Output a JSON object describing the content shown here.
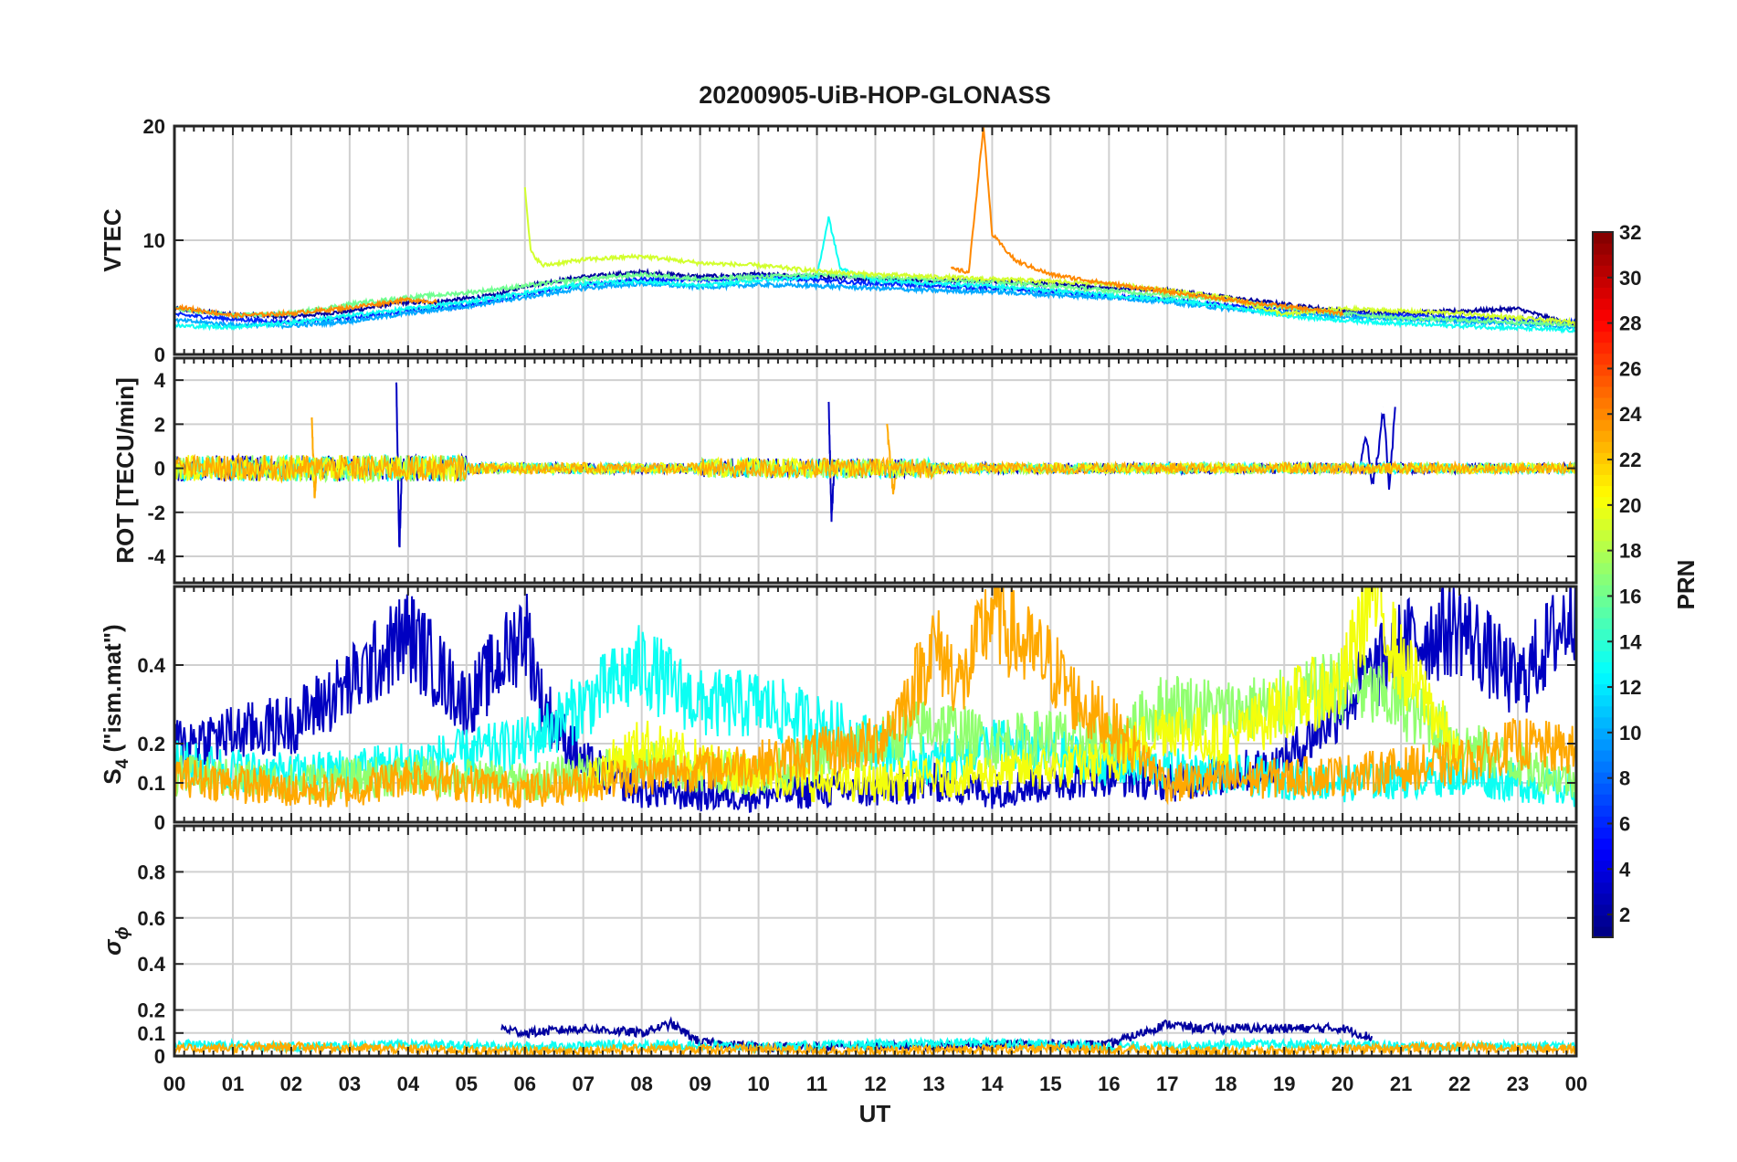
{
  "chart_data": {
    "title": "20200905-UiB-HOP-GLONASS",
    "type": "line",
    "xlabel": "UT",
    "x_tick_labels": [
      "00",
      "01",
      "02",
      "03",
      "04",
      "05",
      "06",
      "07",
      "08",
      "09",
      "10",
      "11",
      "12",
      "13",
      "14",
      "15",
      "16",
      "17",
      "18",
      "19",
      "20",
      "21",
      "22",
      "23",
      "00"
    ],
    "xlim": [
      0,
      24
    ],
    "grid": true,
    "colorbar": {
      "label": "PRN",
      "range": [
        1,
        32
      ],
      "colormap": "jet",
      "ticks": [
        2,
        4,
        6,
        8,
        10,
        12,
        14,
        16,
        18,
        20,
        22,
        24,
        26,
        28,
        30,
        32
      ],
      "tick_labels": [
        "2",
        "4",
        "6",
        "8",
        "10",
        "12",
        "14",
        "16",
        "18",
        "20",
        "22",
        "24",
        "26",
        "28",
        "30",
        "32"
      ]
    },
    "panels": [
      {
        "id": "vtec",
        "ylabel": "VTEC",
        "ylim": [
          0,
          20
        ],
        "yticks": [
          0,
          10,
          20
        ],
        "ytick_labels": [
          "0",
          "10",
          "20"
        ],
        "series": [
          {
            "prn": 2,
            "x": [
              0,
              1,
              2,
              3,
              3.8,
              4.5,
              5.5,
              6,
              7,
              8,
              9,
              10,
              11,
              12,
              13,
              14,
              15,
              16,
              17,
              18,
              19,
              20,
              21,
              22,
              23,
              24
            ],
            "y": [
              4,
              3.5,
              3.3,
              3.8,
              4.5,
              4.6,
              5.2,
              6,
              6.8,
              7.2,
              6.8,
              7,
              6.8,
              6.6,
              6.5,
              6.4,
              6.2,
              5.8,
              5.6,
              5,
              4.4,
              3.8,
              3.6,
              3.8,
              4,
              2.5
            ]
          },
          {
            "prn": 6,
            "x": [
              0,
              1,
              2,
              3,
              4,
              5,
              6,
              7,
              8,
              9,
              10,
              11,
              12,
              13,
              14,
              15,
              16,
              17,
              18,
              19,
              20,
              21,
              22,
              23,
              24
            ],
            "y": [
              3.5,
              3.1,
              2.8,
              3.2,
              3.8,
              4.3,
              5.2,
              6.1,
              6.6,
              6.5,
              6.8,
              6.5,
              6.2,
              6,
              5.8,
              5.5,
              5.1,
              4.8,
              4.3,
              3.9,
              3.6,
              3.4,
              3.2,
              3.1,
              2.8
            ]
          },
          {
            "prn": 10,
            "x": [
              0,
              1,
              2,
              3,
              4,
              5,
              6,
              7,
              8,
              9,
              10,
              11,
              12,
              13,
              14,
              15,
              16,
              17,
              18,
              19,
              20,
              21,
              22,
              23,
              24
            ],
            "y": [
              3,
              2.6,
              2.5,
              2.9,
              3.6,
              4.2,
              5,
              5.8,
              6.2,
              5.9,
              6.1,
              6,
              5.8,
              5.6,
              5.5,
              5.2,
              5,
              4.6,
              4,
              3.6,
              3.3,
              3.1,
              2.9,
              2.7,
              2.4
            ]
          },
          {
            "prn": 13,
            "x": [
              0,
              1,
              2,
              3,
              4,
              5,
              6,
              7,
              8,
              9,
              10,
              11,
              11.2,
              11.4,
              12,
              13,
              14,
              15,
              16,
              17,
              18,
              19,
              20,
              21,
              22,
              23,
              24
            ],
            "y": [
              2.5,
              2.4,
              2.8,
              3.4,
              4,
              4.6,
              5.4,
              6.2,
              6.4,
              6,
              6.5,
              6.8,
              12,
              7.5,
              6.5,
              6.2,
              6,
              5.6,
              5.2,
              4.8,
              4.2,
              3.4,
              3,
              2.7,
              2.5,
              2.3,
              2.1
            ]
          },
          {
            "prn": 16,
            "x": [
              0,
              1,
              2,
              3,
              4,
              5,
              6,
              7,
              8,
              9,
              10,
              11,
              12,
              13,
              14,
              15,
              16,
              17,
              18,
              19,
              20,
              21,
              22,
              23,
              24
            ],
            "y": [
              4,
              3.4,
              3.6,
              4.4,
              5,
              5.4,
              6,
              6.6,
              7,
              6.6,
              6.8,
              7,
              6.8,
              6.6,
              6.4,
              6,
              5.6,
              5.2,
              4.8,
              4.1,
              3.6,
              3.2,
              3,
              2.8,
              2.6
            ]
          },
          {
            "prn": 19,
            "x": [
              6,
              6.1,
              6.3,
              7,
              8,
              9,
              10,
              11,
              12,
              13,
              14,
              15,
              16,
              17,
              18,
              19,
              20,
              21,
              22,
              23,
              24
            ],
            "y": [
              14.5,
              9,
              7.8,
              8.3,
              8.6,
              8,
              7.8,
              7.3,
              7,
              6.8,
              6.6,
              6.4,
              6.2,
              5.6,
              5,
              3.5,
              4,
              3.8,
              3.6,
              3.2,
              2.8
            ]
          },
          {
            "prn": 24,
            "x": [
              0,
              1,
              2,
              3,
              4,
              4.5
            ],
            "y": [
              4.2,
              3.4,
              3.6,
              4.1,
              4.8,
              4.6
            ]
          },
          {
            "prn": 24,
            "x": [
              13.3,
              13.6,
              13.85,
              14,
              14.4,
              15,
              16,
              17,
              18,
              19,
              20
            ],
            "y": [
              7.5,
              7.2,
              20,
              10.5,
              8.2,
              7,
              6.2,
              5.5,
              4.8,
              4.2,
              3.6
            ]
          }
        ]
      },
      {
        "id": "rot",
        "ylabel": "ROT [TECU/min]",
        "ylim": [
          -5.2,
          5
        ],
        "yticks": [
          -4,
          -2,
          0,
          2,
          4
        ],
        "ytick_labels": [
          "-4",
          "-2",
          "0",
          "2",
          "4"
        ],
        "series": [
          {
            "prn": 3,
            "x": [
              3.8,
              3.85,
              3.9
            ],
            "y": [
              3.8,
              -3.8,
              0.5
            ]
          },
          {
            "prn": 3,
            "x": [
              11.2,
              11.25,
              11.3
            ],
            "y": [
              3,
              -2.3,
              0.2
            ]
          },
          {
            "prn": 3,
            "x": [
              20.3,
              20.4,
              20.5,
              20.6,
              20.7,
              20.8,
              20.9
            ],
            "y": [
              0,
              1.6,
              -0.8,
              0.5,
              2.8,
              -1,
              2.8
            ]
          },
          {
            "prn": 23,
            "x": [
              2.35,
              2.4,
              2.45
            ],
            "y": [
              2.3,
              -1.2,
              0.4
            ]
          },
          {
            "prn": 23,
            "x": [
              12.2,
              12.3,
              12.4
            ],
            "y": [
              1.9,
              -1,
              0.3
            ]
          }
        ]
      },
      {
        "id": "s4",
        "ylabel": "S4 (\"ism.mat\")",
        "ylabel_main": "S",
        "ylabel_sub": "4",
        "ylabel_rest": " (\"ism.mat\")",
        "ylim": [
          0,
          0.6
        ],
        "yticks": [
          0,
          0.1,
          0.2,
          0.4
        ],
        "ytick_labels": [
          "0",
          "0.1",
          "0.2",
          "0.4"
        ],
        "series": [
          {
            "prn": 3,
            "x": [
              0,
              2,
              3,
              4,
              5,
              5.8,
              6,
              6.3,
              7,
              8,
              9,
              10,
              11,
              12,
              13,
              14,
              15,
              16,
              17,
              18,
              19,
              20,
              21,
              22,
              23,
              24
            ],
            "y": [
              0.2,
              0.25,
              0.35,
              0.48,
              0.3,
              0.45,
              0.5,
              0.3,
              0.15,
              0.08,
              0.07,
              0.07,
              0.08,
              0.08,
              0.1,
              0.08,
              0.1,
              0.12,
              0.1,
              0.12,
              0.15,
              0.3,
              0.45,
              0.5,
              0.35,
              0.55
            ]
          },
          {
            "prn": 13,
            "x": [
              0,
              2,
              4,
              6,
              7,
              8,
              9,
              10,
              11,
              12,
              13,
              14,
              16,
              18,
              20,
              22,
              24
            ],
            "y": [
              0.15,
              0.12,
              0.15,
              0.2,
              0.3,
              0.4,
              0.3,
              0.3,
              0.25,
              0.2,
              0.15,
              0.2,
              0.15,
              0.12,
              0.1,
              0.12,
              0.08
            ]
          },
          {
            "prn": 17,
            "x": [
              0,
              2,
              4,
              6,
              8,
              10,
              12,
              13,
              14,
              15,
              16,
              17,
              18,
              19,
              20,
              21,
              22,
              23,
              24
            ],
            "y": [
              0.12,
              0.1,
              0.12,
              0.1,
              0.15,
              0.12,
              0.2,
              0.25,
              0.2,
              0.22,
              0.2,
              0.3,
              0.28,
              0.3,
              0.35,
              0.3,
              0.2,
              0.15,
              0.1
            ]
          },
          {
            "prn": 20,
            "x": [
              7,
              8,
              9,
              10,
              11,
              12,
              16,
              17,
              18,
              19,
              20,
              20.5,
              21,
              21.5,
              22
            ],
            "y": [
              0.1,
              0.2,
              0.15,
              0.12,
              0.1,
              0.1,
              0.15,
              0.25,
              0.2,
              0.3,
              0.35,
              0.6,
              0.4,
              0.3,
              0.15
            ]
          },
          {
            "prn": 23,
            "x": [
              0,
              1,
              2,
              3,
              4,
              5,
              6,
              8,
              10,
              12,
              12.5,
              13,
              13.5,
              14,
              14.5,
              15,
              15.5,
              16,
              17,
              20,
              22,
              23,
              24
            ],
            "y": [
              0.12,
              0.1,
              0.08,
              0.08,
              0.12,
              0.1,
              0.08,
              0.12,
              0.15,
              0.2,
              0.3,
              0.45,
              0.35,
              0.55,
              0.45,
              0.4,
              0.3,
              0.25,
              0.1,
              0.12,
              0.15,
              0.2,
              0.18
            ]
          }
        ]
      },
      {
        "id": "sigma",
        "ylabel": "σϕ",
        "ylabel_main": "σ",
        "ylabel_sub": "ϕ",
        "ylim": [
          0,
          1
        ],
        "yticks": [
          0,
          0.1,
          0.2,
          0.4,
          0.6,
          0.8
        ],
        "ytick_labels": [
          "0",
          "0.1",
          "0.2",
          "0.4",
          "0.6",
          "0.8"
        ],
        "series": [
          {
            "prn": 2,
            "x": [
              5.6,
              6,
              7,
              8,
              8.5,
              9,
              9.5,
              10,
              12,
              14,
              16,
              17,
              17.5,
              18,
              19,
              20,
              20.5
            ],
            "y": [
              0.12,
              0.1,
              0.12,
              0.1,
              0.14,
              0.06,
              0.05,
              0.04,
              0.04,
              0.05,
              0.05,
              0.14,
              0.12,
              0.12,
              0.12,
              0.12,
              0.08
            ]
          },
          {
            "prn": 13,
            "x": [
              0,
              2,
              4,
              6,
              8,
              10,
              12,
              14,
              16,
              18,
              20,
              22,
              24
            ],
            "y": [
              0.05,
              0.04,
              0.05,
              0.04,
              0.05,
              0.04,
              0.05,
              0.06,
              0.04,
              0.05,
              0.05,
              0.04,
              0.05
            ]
          },
          {
            "prn": 23,
            "x": [
              0,
              2,
              4,
              6,
              8,
              10,
              12,
              14,
              16,
              18,
              20,
              22,
              24
            ],
            "y": [
              0.03,
              0.04,
              0.03,
              0.02,
              0.03,
              0.03,
              0.02,
              0.03,
              0.03,
              0.02,
              0.03,
              0.04,
              0.03
            ]
          }
        ]
      }
    ]
  }
}
